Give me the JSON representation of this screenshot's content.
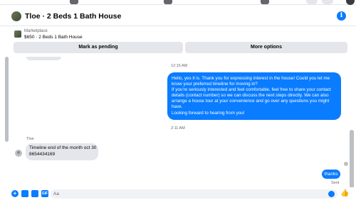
{
  "header": {
    "title": "Tloe · 2 Beds 1 Bath House",
    "info_label": "i"
  },
  "listing": {
    "label": "Marketplace",
    "price_title": "$650 · 2 Beds 1 Bath House",
    "mark_pending_label": "Mark as pending",
    "more_options_label": "More options"
  },
  "conversation": {
    "timestamp_1": "12:15 AM",
    "outgoing_message_lines": [
      "Hello, yes it is. Thank you for expressing interest in the house! Could you let me",
      "know your preferred timeline for moving in?",
      "If you're seriously interested and feel comfortable, feel free to share your contact",
      "details (contact number) so we can discuss the next steps directly. We can also",
      "arrange a house tour at your convenience and go over any questions you might",
      "have.",
      "Looking forward to hearing from you!"
    ],
    "timestamp_2": "2:11 AM",
    "sender_name": "Tloe",
    "incoming_message_lines": [
      "Timeline end of the month oct 30",
      "8654434169"
    ],
    "reply_message": "thanks",
    "sent_status": "Sent"
  },
  "composer": {
    "placeholder": "Aa",
    "icons": [
      "plus-icon",
      "image-icon",
      "sticker-icon",
      "gif-icon",
      "emoji-icon",
      "like-icon"
    ],
    "gif_label": "GIF"
  },
  "colors": {
    "accent": "#0a7cff",
    "bubble_gray": "#e4e6eb",
    "muted_text": "#65676b"
  }
}
